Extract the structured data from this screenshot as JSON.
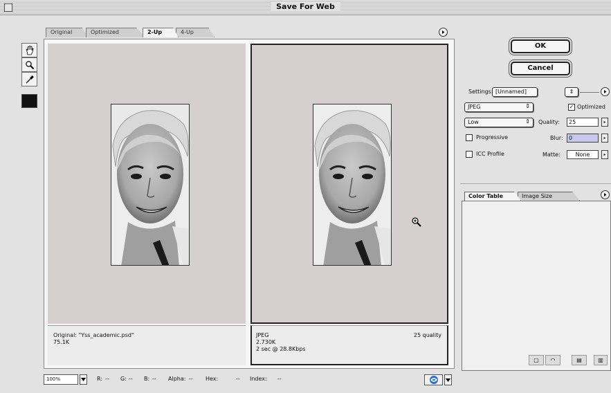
{
  "window": {
    "title": "Save For Web"
  },
  "tabs": [
    {
      "label": "Original",
      "active": false
    },
    {
      "label": "Optimized",
      "active": false
    },
    {
      "label": "2-Up",
      "active": true
    },
    {
      "label": "4-Up",
      "active": false
    }
  ],
  "tools": [
    {
      "name": "hand-tool",
      "icon": "hand-icon"
    },
    {
      "name": "zoom-tool",
      "icon": "magnifier-icon"
    },
    {
      "name": "eyedropper-tool",
      "icon": "eyedropper-icon"
    }
  ],
  "eyedropper_color": "#111111",
  "panes": {
    "original": {
      "line1": "Original: \"Yss_academic.psd\"",
      "line2": "75.1K"
    },
    "optimized": {
      "format": "JPEG",
      "size": "2.730K",
      "download": "2 sec @ 28.8Kbps",
      "quality_label": "25 quality"
    }
  },
  "statusbar": {
    "zoom": "100%",
    "readout": [
      {
        "label": "R:",
        "value": "--"
      },
      {
        "label": "G:",
        "value": "--"
      },
      {
        "label": "B:",
        "value": "--"
      },
      {
        "label": "Alpha:",
        "value": "--"
      },
      {
        "label": "Hex:",
        "value": "--"
      },
      {
        "label": "Index:",
        "value": "--"
      }
    ]
  },
  "buttons": {
    "ok": "OK",
    "cancel": "Cancel"
  },
  "settings": {
    "label": "Settings:",
    "preset": "[Unnamed]",
    "format": "JPEG",
    "quality_preset": "Low",
    "optimized_label": "Optimized",
    "optimized_checked": true,
    "quality_label": "Quality:",
    "quality_value": "25",
    "progressive_label": "Progressive",
    "progressive_checked": false,
    "blur_label": "Blur:",
    "blur_value": "0",
    "icc_label": "ICC Profile",
    "icc_checked": false,
    "matte_label": "Matte:",
    "matte_value": "None"
  },
  "panel_tabs": [
    {
      "label": "Color Table",
      "active": true
    },
    {
      "label": "Image Size",
      "active": false
    }
  ],
  "colors": {
    "pane_bg": "#d5d0cf",
    "window_bg": "#e2e2e2",
    "blur_field_bg": "#c8c8ec"
  }
}
